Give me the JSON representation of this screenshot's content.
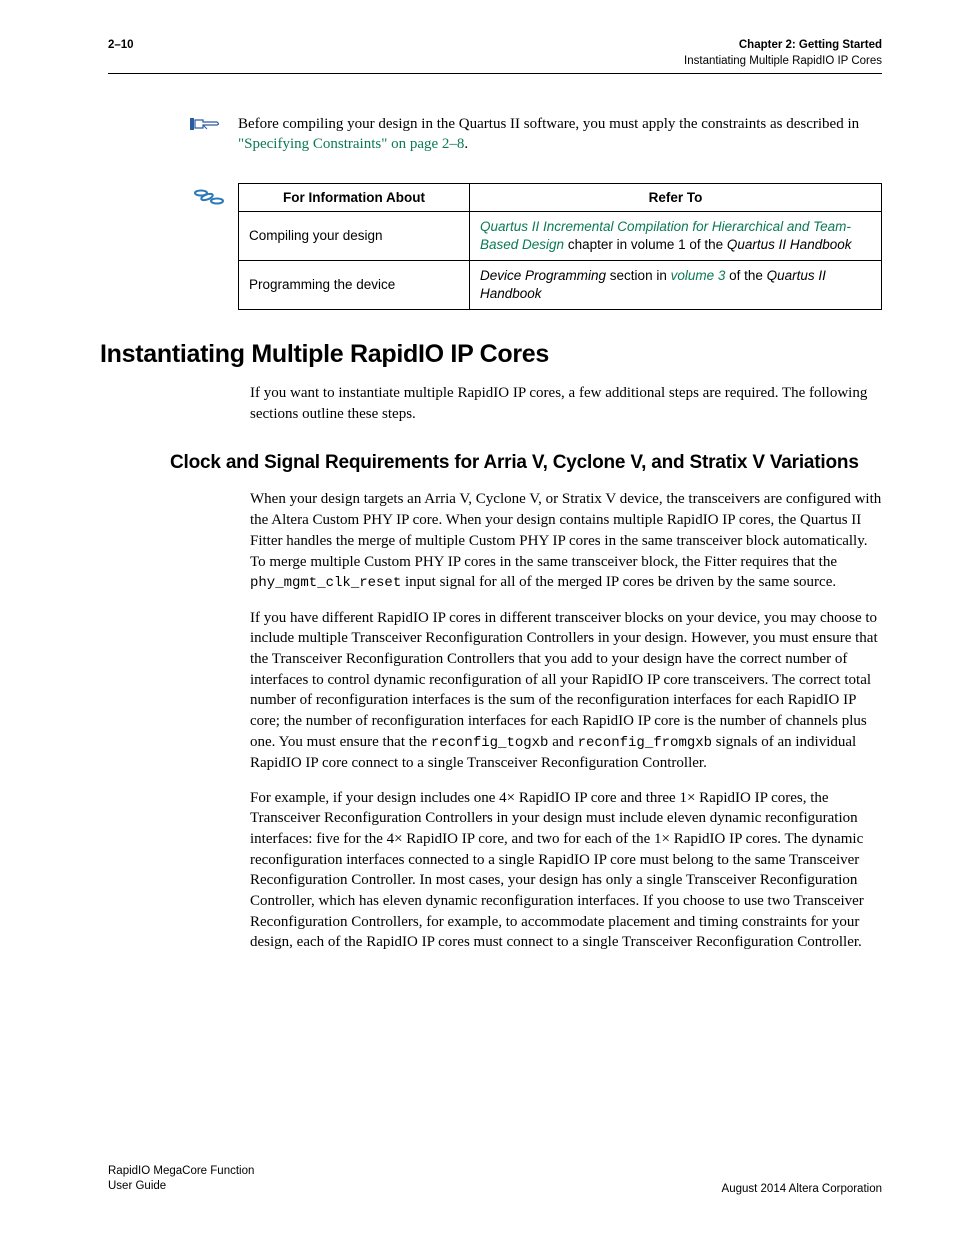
{
  "header": {
    "page_num": "2–10",
    "chapter": "Chapter 2:  Getting Started",
    "section_name": "Instantiating Multiple RapidIO IP Cores"
  },
  "note": {
    "text_before_link": "Before compiling your design in the Quartus II software, you must apply the constraints as described in ",
    "link_text": "\"Specifying Constraints\" on page 2–8",
    "text_after_link": "."
  },
  "table": {
    "headers": {
      "col1": "For Information About",
      "col2": "Refer To"
    },
    "rows": [
      {
        "info": "Compiling your design",
        "refer_link": "Quartus II Incremental Compilation for Hierarchical and Team-Based Design",
        "refer_rest1": " chapter in volume 1 of the ",
        "refer_italic": "Quartus II Handbook"
      },
      {
        "info": "Programming the device",
        "refer_pre_italic": "Device Programming",
        "refer_mid1": " section in ",
        "refer_link": "volume 3",
        "refer_mid2": " of the ",
        "refer_italic": "Quartus II Handbook"
      }
    ]
  },
  "h1": "Instantiating Multiple RapidIO IP Cores",
  "intro": "If you want to instantiate multiple RapidIO IP cores, a few additional steps are required. The following sections outline these steps.",
  "h2": "Clock and Signal Requirements for Arria V, Cyclone V, and Stratix V Variations",
  "p1_a": "When your design targets an Arria V, Cyclone V, or Stratix V device, the transceivers are configured with the Altera Custom PHY IP core. When your design contains multiple RapidIO IP cores, the Quartus II Fitter handles the merge of multiple Custom PHY IP cores in the same transceiver block automatically. To merge multiple Custom PHY IP cores in the same transceiver block, the Fitter requires that the ",
  "p1_code": "phy_mgmt_clk_reset",
  "p1_b": " input signal for all of the merged IP cores be driven by the same source.",
  "p2_a": "If you have different RapidIO IP cores in different transceiver blocks on your device, you may choose to include multiple Transceiver Reconfiguration Controllers in your design. However, you must ensure that the Transceiver Reconfiguration Controllers that you add to your design have the correct number of interfaces to control dynamic reconfiguration of all your RapidIO IP core transceivers. The correct total number of reconfiguration interfaces is the sum of the reconfiguration interfaces for each RapidIO IP core; the number of reconfiguration interfaces for each RapidIO IP core is the number of channels plus one. You must ensure that the ",
  "p2_code1": "reconfig_togxb",
  "p2_mid": " and ",
  "p2_code2": "reconfig_fromgxb",
  "p2_b": " signals of an individual RapidIO IP core connect to a single Transceiver Reconfiguration Controller.",
  "p3": "For example, if your design includes one 4× RapidIO IP core and three 1× RapidIO IP cores, the Transceiver Reconfiguration Controllers in your design must include eleven dynamic reconfiguration interfaces: five for the 4× RapidIO IP core, and two for each of the 1× RapidIO IP cores. The dynamic reconfiguration interfaces connected to a single RapidIO IP core must belong to the same Transceiver Reconfiguration Controller. In most cases, your design has only a single Transceiver Reconfiguration Controller, which has eleven dynamic reconfiguration interfaces. If you choose to use two Transceiver Reconfiguration Controllers, for example, to accommodate placement and timing constraints for your design, each of the RapidIO IP cores must connect to a single Transceiver Reconfiguration Controller.",
  "footer": {
    "left1": "RapidIO MegaCore Function",
    "left2": "User Guide",
    "right": "August 2014   Altera Corporation"
  }
}
